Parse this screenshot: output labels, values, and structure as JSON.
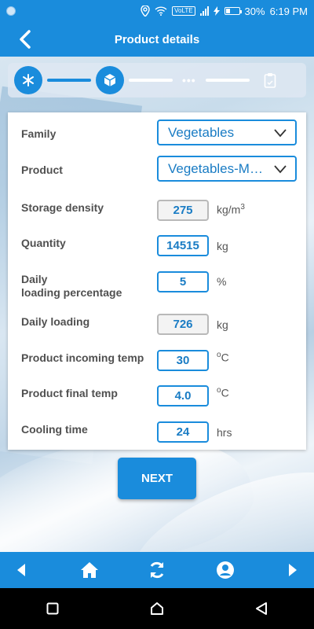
{
  "status": {
    "battery": "30%",
    "time": "6:19 PM",
    "network_badge": "VoLTE",
    "battery_level": 0.3
  },
  "header": {
    "title": "Product details"
  },
  "form": {
    "family": {
      "label": "Family",
      "value": "Vegetables"
    },
    "product": {
      "label": "Product",
      "value": "Vegetables-Mean..."
    },
    "storage_density": {
      "label": "Storage density",
      "value": "275",
      "unit": "kg/m",
      "unit_sup": "3"
    },
    "quantity": {
      "label": "Quantity",
      "value": "14515",
      "unit": "kg"
    },
    "daily_loading_pct": {
      "label_line1": "Daily",
      "label_line2": "loading percentage",
      "value": "5",
      "unit": "%"
    },
    "daily_loading": {
      "label": "Daily loading",
      "value": "726",
      "unit": "kg"
    },
    "incoming_temp": {
      "label": "Product incoming temp",
      "value": "30",
      "unit_sup": "o",
      "unit": "C"
    },
    "final_temp": {
      "label": "Product final temp",
      "value": "4.0",
      "unit_sup": "o",
      "unit": "C"
    },
    "cooling_time": {
      "label": "Cooling time",
      "value": "24",
      "unit": "hrs"
    }
  },
  "next_label": "NEXT",
  "stepper": {
    "dots": "•••"
  },
  "colors": {
    "accent": "#1a8cdc",
    "field_text": "#1a7cc4"
  },
  "icons": [
    "back-arrow-icon",
    "snowflake-icon",
    "cube-icon",
    "clipboard-icon",
    "home-icon",
    "refresh-icon",
    "user-icon",
    "arrow-left-icon",
    "arrow-right-icon"
  ]
}
